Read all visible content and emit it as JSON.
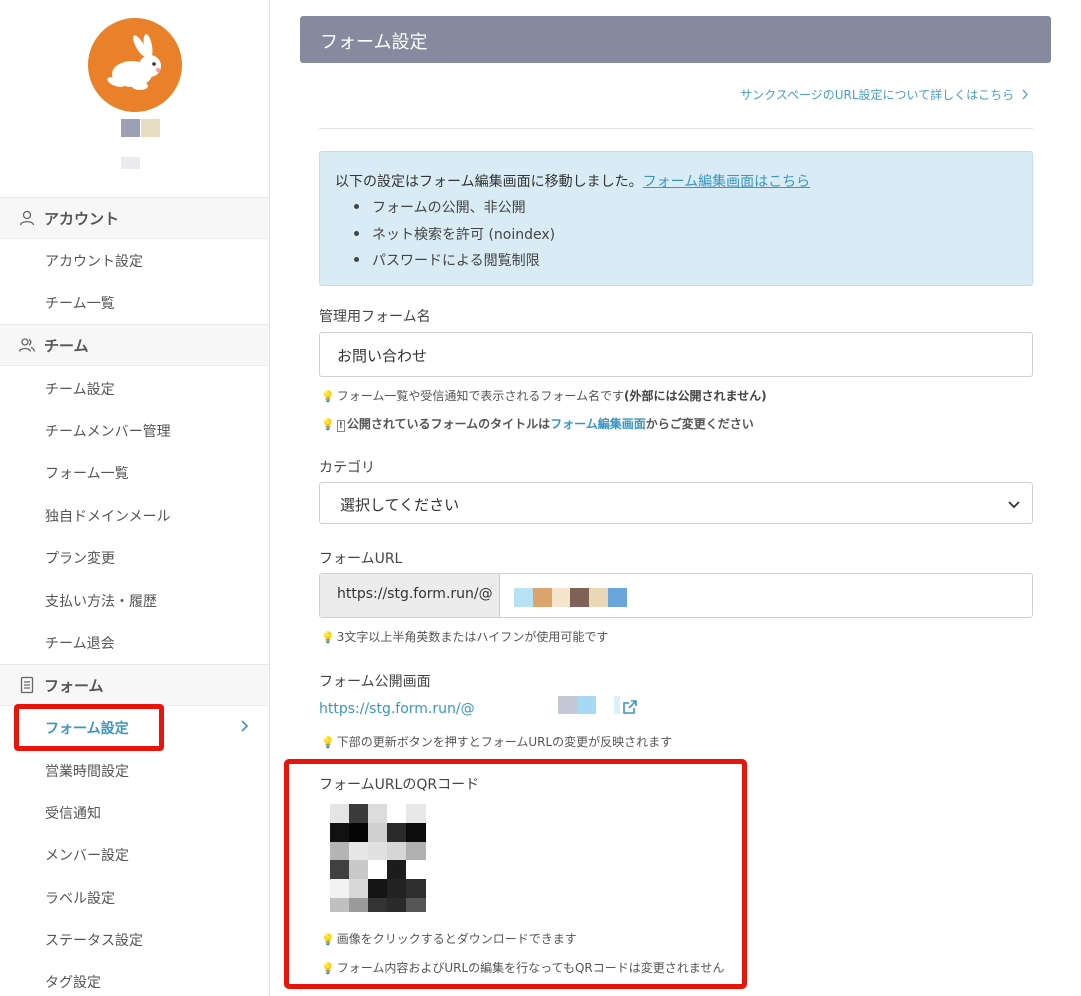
{
  "sidebar": {
    "sections": [
      {
        "title": "アカウント",
        "items": [
          "アカウント設定",
          "チーム一覧"
        ]
      },
      {
        "title": "チーム",
        "items": [
          "チーム設定",
          "チームメンバー管理",
          "フォーム一覧",
          "独自ドメインメール",
          "プラン変更",
          "支払い方法・履歴",
          "チーム退会"
        ]
      },
      {
        "title": "フォーム",
        "active": "フォーム設定",
        "items": [
          "営業時間設定",
          "受信通知",
          "メンバー設定",
          "ラベル設定",
          "ステータス設定",
          "タグ設定"
        ]
      }
    ]
  },
  "main": {
    "header_title": "フォーム設定",
    "thanks_link": "サンクスページのURL設定について詳しくはこちら",
    "info": {
      "text": "以下の設定はフォーム編集画面に移動しました。",
      "link": "フォーム編集画面はこちら",
      "bullets": [
        "フォームの公開、非公開",
        "ネット検索を許可 (noindex)",
        "パスワードによる閲覧制限"
      ]
    },
    "form_name": {
      "label": "管理用フォーム名",
      "value": "お問い合わせ",
      "hint1_a": "フォーム一覧や受信通知で表示されるフォーム名です",
      "hint1_b": "(外部には公開されません)",
      "hint2_a": "公開されているフォームのタイトルは",
      "hint2_link": "フォーム編集画面",
      "hint2_b": "からご変更ください"
    },
    "category": {
      "label": "カテゴリ",
      "value": "選択してください"
    },
    "form_url": {
      "label": "フォームURL",
      "prefix": "https://stg.form.run/@",
      "hint": "3文字以上半角英数またはハイフンが使用可能です"
    },
    "public_page": {
      "label": "フォーム公開画面",
      "url": "https://stg.form.run/@",
      "hint": "下部の更新ボタンを押すとフォームURLの変更が反映されます"
    },
    "qr": {
      "label": "フォームURLのQRコード",
      "hint1": "画像をクリックするとダウンロードできます",
      "hint2": "フォーム内容およびURLの編集を行なってもQRコードは変更されません"
    }
  },
  "colors": {
    "accent": "#3a96c2",
    "header": "#868a9e",
    "highlight": "#e8140c",
    "avatar": "#e9812a"
  }
}
